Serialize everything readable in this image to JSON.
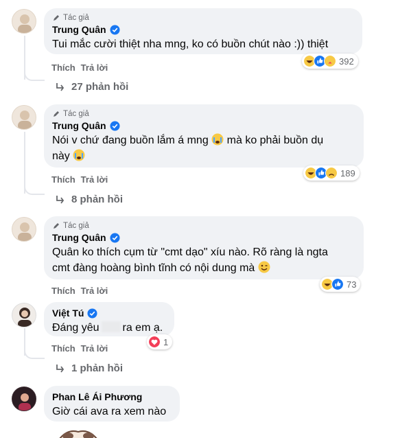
{
  "comments": [
    {
      "author_tag": "Tác giả",
      "name": "Trung Quân",
      "text": "Tui mắc cười thiệt nha mng, ko có buồn chút nào :)) thiệt",
      "actions": {
        "like": "Thích",
        "reply": "Trả lời"
      },
      "reactions": {
        "icons": [
          "haha-icon",
          "like-icon",
          "care-icon"
        ],
        "count": "392"
      },
      "replies": "27 phản hồi"
    },
    {
      "author_tag": "Tác giả",
      "name": "Trung Quân",
      "text_line1": "Nói v chứ đang buồn lắm á mng",
      "text_line1_tail": "mà ko phải buồn dụ",
      "text_line2": "này",
      "emoji": "crying-face-icon",
      "actions": {
        "like": "Thích",
        "reply": "Trả lời"
      },
      "reactions": {
        "icons": [
          "haha-icon",
          "like-icon",
          "sad-icon"
        ],
        "count": "189"
      },
      "replies": "8 phản hồi"
    },
    {
      "author_tag": "Tác giả",
      "name": "Trung Quân",
      "text_line1": "Quân ko thích cụm từ \"cmt dạo\" xíu nào. Rõ ràng là ngta",
      "text_line2": "cmt đàng hoàng bình tĩnh có nội dung mà",
      "emoji": "wink-face-icon",
      "actions": {
        "like": "Thích",
        "reply": "Trả lời"
      },
      "reactions": {
        "icons": [
          "haha-icon",
          "like-icon"
        ],
        "count": "73"
      }
    },
    {
      "name": "Việt Tú",
      "text_a": "Đáng yêu",
      "text_b": "ra em ạ.",
      "actions": {
        "like": "Thích",
        "reply": "Trả lời"
      },
      "reactions": {
        "icons": [
          "love-icon"
        ],
        "count": "1"
      },
      "replies": "1 phản hồi"
    },
    {
      "name": "Phan Lê Ái Phương",
      "text": "Giờ cái ava ra xem nào"
    }
  ],
  "colors": {
    "bubble": "#f0f2f5",
    "verified": "#1877f2",
    "secondary_text": "#65676b",
    "like_blue": "#1877f2",
    "haha_yellow": "#f7c945",
    "love_red": "#f33e58"
  }
}
